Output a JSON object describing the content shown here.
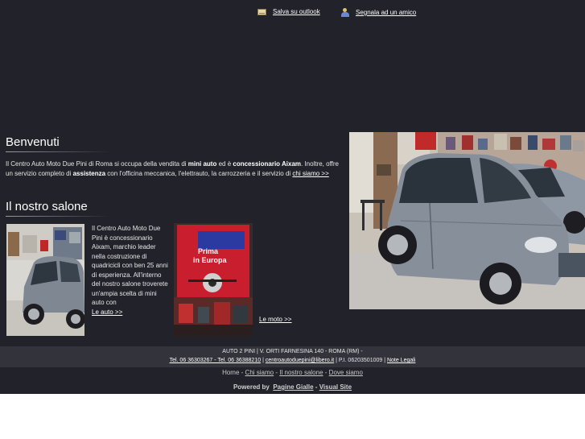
{
  "top_links": {
    "outlook": "Salva su outlook",
    "friend": "Segnala ad un amico"
  },
  "welcome": {
    "title": "Benvenuti",
    "text_1": "Il Centro Auto Moto Due Pini di Roma si occupa della vendita di ",
    "bold_1": "mini auto",
    "text_2": " ed è ",
    "bold_2": "concessionario Aixam",
    "text_3": ". Inoltre, offre un servizio completo di ",
    "bold_3": "assistenza",
    "text_4": " con l'officina meccanica, l'elettrauto, la carrozzeria e il servizio di ",
    "link": "chi siamo >>"
  },
  "salone": {
    "title": "Il nostro salone",
    "text": "Il Centro Auto Moto Due Pini è concessionario Aixam, marchio leader nella costruzione di quadricicli con ben 25 anni di esperienza. All'interno del nostro salone troverete un'ampia scelta di mini auto con",
    "auto_link": "Le auto >>",
    "moto_link": "Le moto >>",
    "poster_line1": "Prima",
    "poster_line2": "in Europa"
  },
  "footer": {
    "address": "AUTO 2 PINI | V. ORTI FARNESINA 140 - ROMA (RM) -",
    "tel": "Tel. 06 36303267 - Tel. 06 36388210",
    "email": "centroautoduepini@libero.it",
    "piva": "P.I. 06203501009",
    "legal": "Note Legali",
    "nav": [
      "Home",
      "Chi siamo",
      "Il nostro salone",
      "Dove siamo"
    ],
    "separator": "-",
    "powered_label": "Powered by",
    "powered_1": "Pagine Gialle",
    "powered_2": "Visual Site"
  }
}
